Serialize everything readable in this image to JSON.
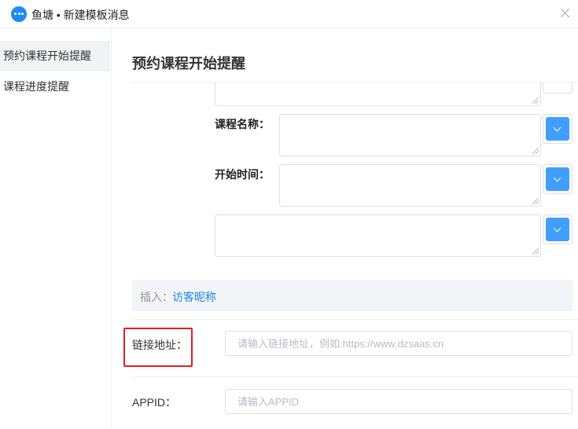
{
  "window": {
    "title": "鱼塘 • 新建模板消息"
  },
  "sidebar": {
    "items": [
      {
        "label": "预约课程开始提醒",
        "active": true
      },
      {
        "label": "课程进度提醒",
        "active": false
      }
    ]
  },
  "main": {
    "title": "预约课程开始提醒",
    "fields": [
      {
        "label": "课程名称：",
        "value": ""
      },
      {
        "label": "开始时间：",
        "value": ""
      },
      {
        "label": "",
        "value": ""
      }
    ],
    "insert": {
      "prefix": "插入：",
      "link": "访客昵称"
    },
    "link_field": {
      "label": "链接地址：",
      "value": "",
      "placeholder": "请输入链接地址，例如:https://www.dzsaas.cn"
    },
    "appid_field": {
      "label": "APPID：",
      "value": "",
      "placeholder": "请输入APPID"
    }
  },
  "colors": {
    "accent": "#409eff",
    "brand": "#1e8cf0",
    "highlight_border": "#e02020",
    "link": "#1e88e5"
  }
}
